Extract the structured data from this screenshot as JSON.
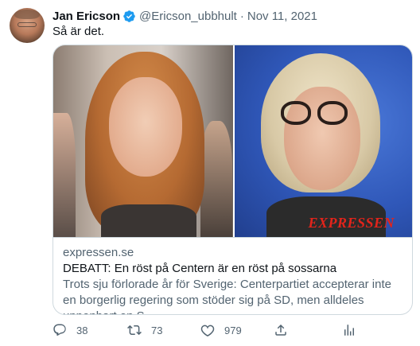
{
  "tweet": {
    "author_name": "Jan Ericson",
    "handle": "@Ericson_ubbhult",
    "separator": "·",
    "date": "Nov 11, 2021",
    "text": "Så är det."
  },
  "card": {
    "brand_logo": "EXPRESSEN",
    "domain": "expressen.se",
    "title": "DEBATT: En röst på Centern är en röst på sossarna",
    "description": "Trots sju förlorade år för Sverige: Centerpartiet accepterar inte en borgerlig regering som stöder sig på SD, men alldeles uppenbart en S-..."
  },
  "actions": {
    "replies": "38",
    "retweets": "73",
    "likes": "979"
  },
  "colors": {
    "text_primary": "#0f1419",
    "text_secondary": "#536471",
    "verified_blue": "#1d9bf0",
    "border": "#cfd9de",
    "brand_red": "#e2241b"
  },
  "icons": [
    "verified-badge-icon",
    "reply-icon",
    "retweet-icon",
    "like-icon",
    "share-icon",
    "analytics-icon"
  ]
}
